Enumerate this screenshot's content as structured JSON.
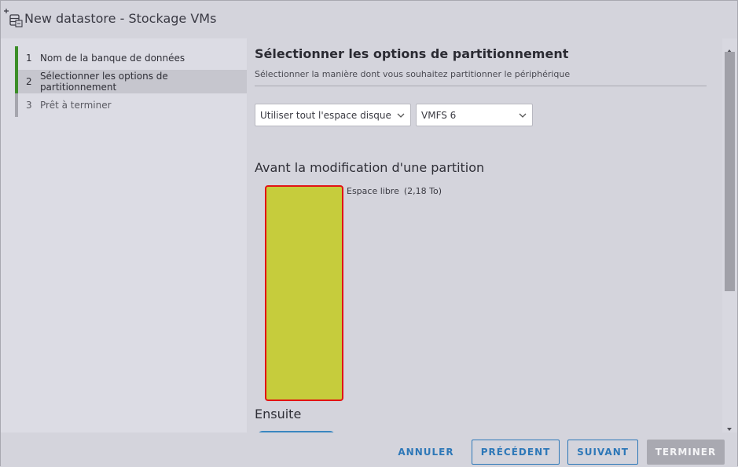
{
  "window": {
    "title": "New datastore - Stockage VMs",
    "icon": "new-datastore-icon"
  },
  "steps": [
    {
      "num": "1",
      "label": "Nom de la banque de données",
      "state": "done"
    },
    {
      "num": "2",
      "label": "Sélectionner les options de partitionnement",
      "state": "active"
    },
    {
      "num": "3",
      "label": "Prêt à terminer",
      "state": "todo"
    }
  ],
  "main": {
    "title": "Sélectionner les options de partitionnement",
    "subtitle": "Sélectionner la manière dont vous souhaitez partitionner le périphérique",
    "partition_select": {
      "value": "Utiliser tout l'espace disque"
    },
    "vmfs_select": {
      "value": "VMFS 6"
    },
    "before_title": "Avant la modification d'une partition",
    "partition": {
      "label": "Espace libre",
      "size": "(2,18 To)"
    },
    "after_title": "Ensuite"
  },
  "footer": {
    "cancel": "ANNULER",
    "previous": "PRÉCÉDENT",
    "next": "SUIVANT",
    "finish": "TERMINER"
  },
  "colors": {
    "accent": "#2e78b8",
    "step_done": "#3c8e28",
    "partition_fill": "#c6cc3c",
    "partition_border": "#e21414"
  }
}
